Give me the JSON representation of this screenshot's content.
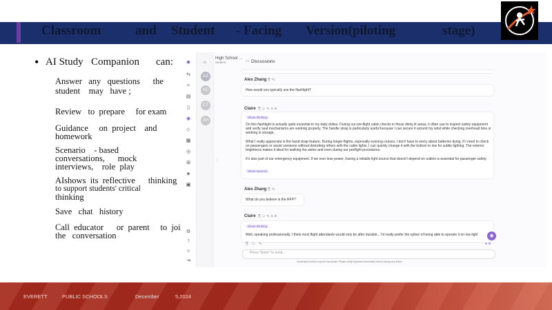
{
  "slide": {
    "title_words": [
      "Classroom",
      "and",
      "Student",
      "- Facing",
      "Version(piloting",
      "stage)"
    ]
  },
  "bullets": {
    "heading_words": [
      "AI Study",
      "Companion",
      "can:"
    ],
    "items": [
      {
        "line1": "Answer   any   questions      the",
        "line2": "student    may   have ;"
      },
      {
        "line1": "Review   to  prepare     for exam",
        "line2": ""
      },
      {
        "line1": "Guidance     on  project    and",
        "line2": "homework"
      },
      {
        "line1": "Scenario    - based",
        "line2": "conversations,      mock",
        "line3": "interviews,    role  play"
      },
      {
        "line1": "AIshows  its  reflective      thinking",
        "line2": "to support students' critical",
        "line3": "thinking"
      },
      {
        "line1": "Save   chat   history",
        "line2": ""
      },
      {
        "line1": "Call  educator      or  parent     to  join",
        "line2": "the   conversation"
      }
    ]
  },
  "app": {
    "sidebar_title": "High School ...",
    "sidebar_subtitle": "Student",
    "breadcrumb": "Discussions",
    "avatars": [
      "AZ",
      "AC",
      "CT",
      "AH"
    ],
    "messages": [
      {
        "sender": "Alex Zhang",
        "text": "How would you typically use the flashlight?"
      },
      {
        "sender": "Claire",
        "chip": "Show thinking",
        "text": "On this flashlight is actually quite essential in my daily duties. During our pre-flight cabin checks in those dimly lit areas, it often use to inspect safety equipment and verify seat mechanisms are working properly. The handle strap is particularly useful because I can secure it around my wrist while checking overhead bins or working in storage.",
        "text2": "What I really appreciate is the hand strap feature. During longer flights, especially evening cruises, I don't have to worry about batteries dying. If I need to check on passengers or assist someone without disturbing others with the cabin lights, I can quickly change it with the bottom to low for subtle lighting. The exterior brightness makes it ideal for walking the aisles and even during our preflight procedures.",
        "text3": "It's also part of our emergency equipment. If we ever lose power, having a reliable light source that doesn't depend on outlets is essential for passenger safety.",
        "chip2": "Show sources"
      },
      {
        "sender": "Alex Zhang",
        "text": "What do you believe is the RFP?"
      },
      {
        "sender": "Claire",
        "chip": "Show thinking",
        "text": "Well, speaking professionally, I think most flight attendants would only be after durable... I'd really prefer the option of being able to operate it on low light"
      }
    ],
    "input_placeholder": "Press \"Enter\" to send...",
    "footnote": "Generated content may be inaccurate. Please verify important information before taking any action."
  },
  "footer": {
    "org1": "EVERETT",
    "org2": "PUBLIC SCHOOLS",
    "month": "December",
    "date": "5,2024"
  },
  "colors": {
    "title_bar": "#1a2f6b",
    "accent": "#6b3fa0",
    "footer": "#a52a1c",
    "send_button": "#8a63d2"
  }
}
